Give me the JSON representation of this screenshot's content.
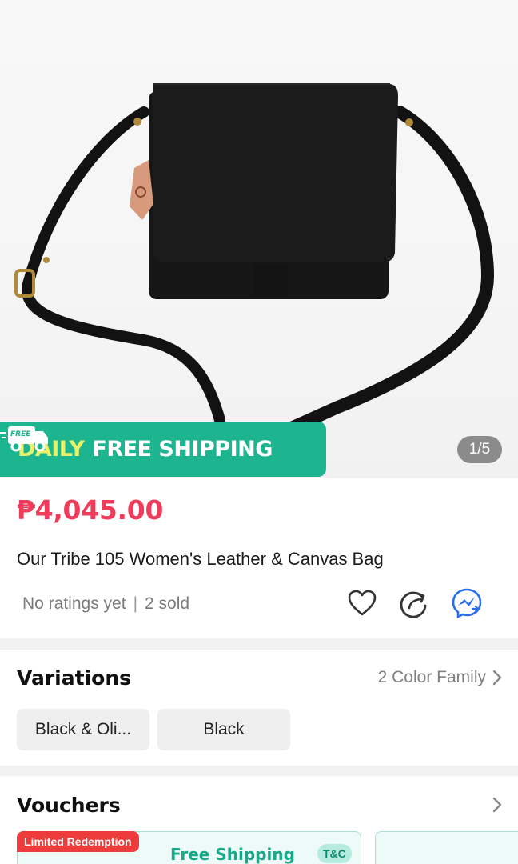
{
  "product": {
    "image_counter": "1/5",
    "image_alt": "Black leather crossbody bag with strap"
  },
  "banner": {
    "truck_label": "FREE",
    "daily": "DAILY",
    "free_shipping": "FREE SHIPPING",
    "colors": {
      "background": "#1db58f",
      "daily": "#e7f26a"
    }
  },
  "info": {
    "price": "₱4,045.00",
    "title": "Our Tribe 105 Women's Leather & Canvas Bag",
    "ratings": "No ratings yet",
    "separator": "|",
    "sold": "2 sold",
    "actions": [
      {
        "name": "wishlist",
        "icon": "heart-icon"
      },
      {
        "name": "share",
        "icon": "share-icon"
      },
      {
        "name": "messenger",
        "icon": "messenger-icon"
      }
    ],
    "colors": {
      "price": "#f03c5a"
    }
  },
  "variations": {
    "title": "Variations",
    "link": "2 Color Family",
    "options": [
      "Black & Oli...",
      "Black"
    ]
  },
  "vouchers": {
    "title": "Vouchers",
    "items": [
      {
        "badge": "Limited Redemption",
        "label": "Free Shipping",
        "tc": "T&C"
      }
    ],
    "colors": {
      "accent": "#17a98a",
      "badge": "#ee3b3b"
    }
  }
}
